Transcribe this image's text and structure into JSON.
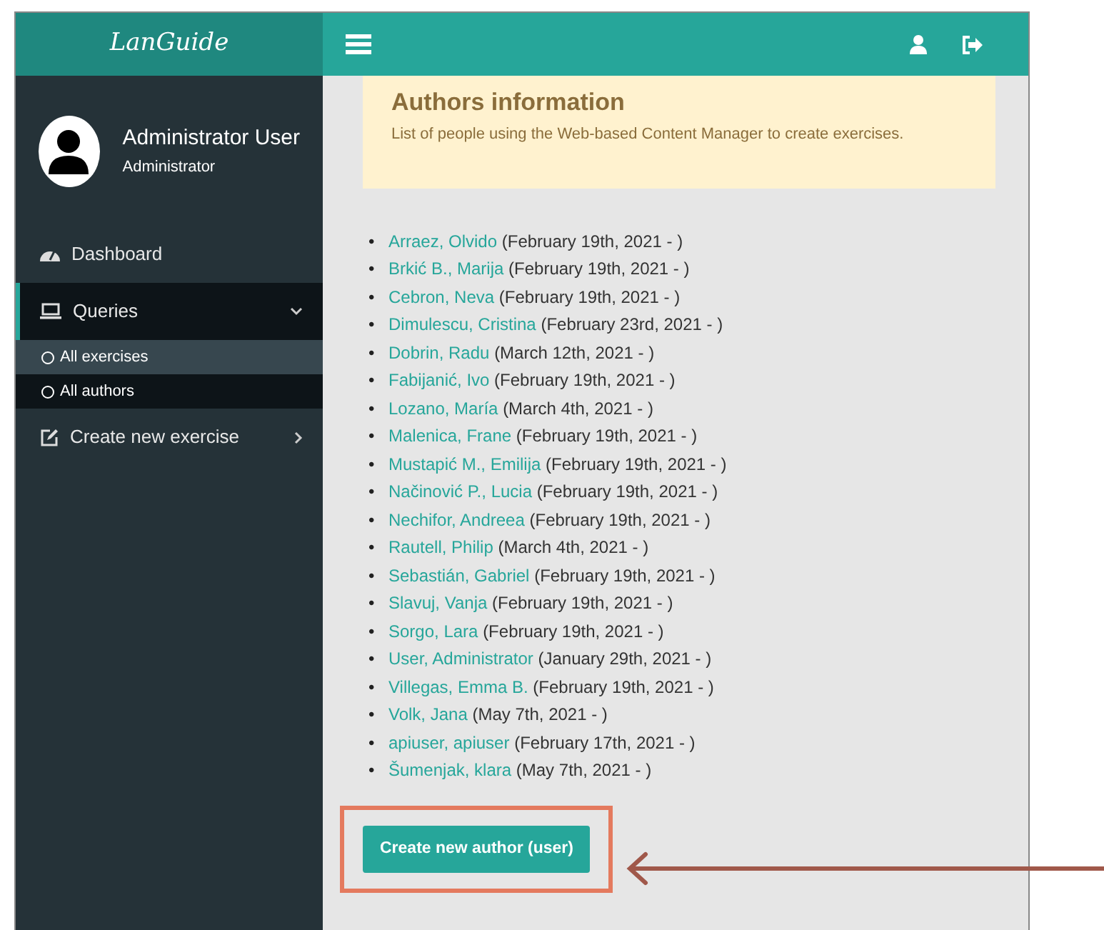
{
  "brand": "LanGuide",
  "user": {
    "name": "Administrator User",
    "role": "Administrator"
  },
  "menu": [
    {
      "kind": "item",
      "label": "Dashboard",
      "selected": false
    },
    {
      "kind": "group",
      "label": "Queries",
      "selected": true,
      "expanded": true,
      "children": [
        {
          "label": "All exercises",
          "selected": false
        },
        {
          "label": "All authors",
          "selected": true
        }
      ]
    },
    {
      "kind": "group",
      "label": "Create new exercise",
      "selected": false,
      "expanded": false
    }
  ],
  "notice": {
    "title": "Authors information",
    "text": "List of people using the Web-based Content Manager to create exercises."
  },
  "bullet": "•",
  "authors": [
    {
      "name": "Arraez, Olvido",
      "since": "(February 19th, 2021 - )"
    },
    {
      "name": "Brkić B., Marija",
      "since": "(February 19th, 2021 - )"
    },
    {
      "name": "Cebron, Neva",
      "since": "(February 19th, 2021 - )"
    },
    {
      "name": "Dimulescu, Cristina",
      "since": "(February 23rd, 2021 - )"
    },
    {
      "name": "Dobrin, Radu",
      "since": "(March 12th, 2021 - )"
    },
    {
      "name": "Fabijanić, Ivo",
      "since": "(February 19th, 2021 - )"
    },
    {
      "name": "Lozano, María",
      "since": "(March 4th, 2021 - )"
    },
    {
      "name": "Malenica, Frane",
      "since": "(February 19th, 2021 - )"
    },
    {
      "name": "Mustapić M., Emilija",
      "since": "(February 19th, 2021 - )"
    },
    {
      "name": "Načinović P., Lucia",
      "since": "(February 19th, 2021 - )"
    },
    {
      "name": "Nechifor, Andreea",
      "since": "(February 19th, 2021 - )"
    },
    {
      "name": "Rautell, Philip",
      "since": "(March 4th, 2021 - )"
    },
    {
      "name": "Sebastián, Gabriel",
      "since": "(February 19th, 2021 - )"
    },
    {
      "name": "Slavuj, Vanja",
      "since": "(February 19th, 2021 - )"
    },
    {
      "name": "Sorgo, Lara",
      "since": "(February 19th, 2021 - )"
    },
    {
      "name": "User, Administrator",
      "since": "(January 29th, 2021 - )"
    },
    {
      "name": "Villegas, Emma B.",
      "since": "(February 19th, 2021 - )"
    },
    {
      "name": "Volk, Jana",
      "since": "(May 7th, 2021 - )"
    },
    {
      "name": "apiuser, apiuser",
      "since": "(February 17th, 2021 - )"
    },
    {
      "name": "Šumenjak, klara",
      "since": "(May 7th, 2021 - )"
    }
  ],
  "create_button": "Create new author (user)"
}
